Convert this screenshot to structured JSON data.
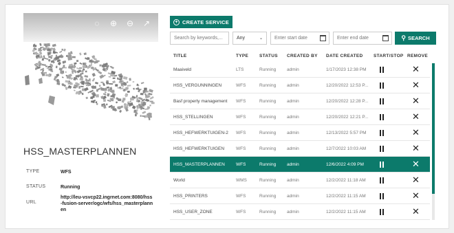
{
  "map_tools": [
    "locate-icon",
    "zoom-in-icon",
    "zoom-out-icon",
    "open-external-icon"
  ],
  "detail": {
    "title": "HSS_MASTERPLANNEN",
    "type_label": "TYPE",
    "type_value": "WFS",
    "status_label": "STATUS",
    "status_value": "Running",
    "url_label": "URL",
    "url_value": "http://leu-vsvcp22.ingrnet.com:8080/hss-fusion-server/ogc/wfs/hss_masterplannen"
  },
  "toolbar": {
    "create_label": "CREATE SERVICE",
    "search_placeholder": "Search by keywords,...",
    "type_select_value": "Any",
    "start_date_placeholder": "Enter start date",
    "end_date_placeholder": "Enter end date",
    "search_label": "SEARCH"
  },
  "table": {
    "headers": [
      "TITLE",
      "TYPE",
      "STATUS",
      "CREATED BY",
      "DATE CREATED",
      "START/STOP",
      "REMOVE"
    ],
    "rows": [
      {
        "title": "Maaiveld",
        "type": "LTS",
        "status": "Running",
        "created_by": "admin",
        "date": "1/17/2023 12:38 PM"
      },
      {
        "title": "HSS_VERGUNNINGEN",
        "type": "WFS",
        "status": "Running",
        "created_by": "admin",
        "date": "12/20/2022 12:53 P..."
      },
      {
        "title": "Basf property management",
        "type": "WFS",
        "status": "Running",
        "created_by": "admin",
        "date": "12/20/2022 12:28 P..."
      },
      {
        "title": "HSS_STELLINGEN",
        "type": "WFS",
        "status": "Running",
        "created_by": "admin",
        "date": "12/20/2022 12:21 P..."
      },
      {
        "title": "HSS_HEFWERKTUIGEN-2",
        "type": "WFS",
        "status": "Running",
        "created_by": "admin",
        "date": "12/13/2022 5:57 PM"
      },
      {
        "title": "HSS_HEFWERKTUIGEN",
        "type": "WFS",
        "status": "Running",
        "created_by": "admin",
        "date": "12/7/2022 10:03 AM"
      },
      {
        "title": "HSS_MASTERPLANNEN",
        "type": "WFS",
        "status": "Running",
        "created_by": "admin",
        "date": "12/6/2022 4:09 PM"
      },
      {
        "title": "World",
        "type": "WMS",
        "status": "Running",
        "created_by": "admin",
        "date": "12/2/2022 11:18 AM"
      },
      {
        "title": "HSS_PRINTERS",
        "type": "WFS",
        "status": "Running",
        "created_by": "admin",
        "date": "12/2/2022 11:15 AM"
      },
      {
        "title": "HSS_USER_ZONE",
        "type": "WFS",
        "status": "Running",
        "created_by": "admin",
        "date": "12/2/2022 11:15 AM"
      }
    ],
    "selected_index": 6
  },
  "colors": {
    "accent": "#0c7a6b",
    "selected_text": "#ffffff"
  }
}
